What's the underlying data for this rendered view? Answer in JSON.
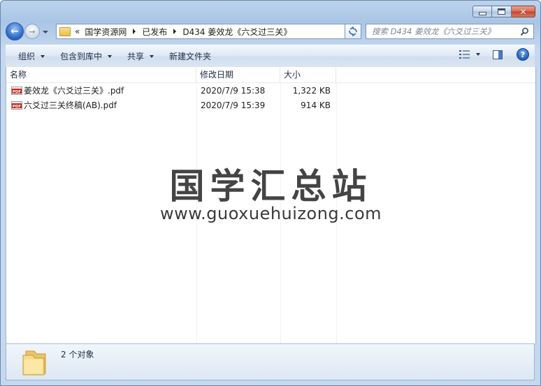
{
  "window": {
    "caption": {
      "minimize_glyph": "",
      "close_glyph": "✕"
    }
  },
  "nav": {
    "address": {
      "overflow": "«",
      "crumbs": [
        "国学资源网",
        "已发布",
        "D434 姜效龙《六爻过三关》"
      ]
    },
    "search_placeholder": "搜索 D434 姜效龙《六爻过三关》"
  },
  "toolbar": {
    "organize": "组织",
    "include_in_library": "包含到库中",
    "share": "共享",
    "new_folder": "新建文件夹",
    "help": "?"
  },
  "columns": {
    "name": "名称",
    "date": "修改日期",
    "size": "大小"
  },
  "files": [
    {
      "name": "姜效龙《六爻过三关》.pdf",
      "date": "2020/7/9 15:38",
      "size": "1,322 KB",
      "icon": "pdf-icon"
    },
    {
      "name": "六爻过三关终稿(AB).pdf",
      "date": "2020/7/9 15:39",
      "size": "914 KB",
      "icon": "pdf-icon"
    }
  ],
  "watermark": {
    "title": "国学汇总站",
    "url": "www.guoxuehuizong.com"
  },
  "details": {
    "item_count": "2 个对象"
  },
  "colors": {
    "frame": "#a9c5e6",
    "accent": "#2f6ed0",
    "close": "#c3412a"
  }
}
